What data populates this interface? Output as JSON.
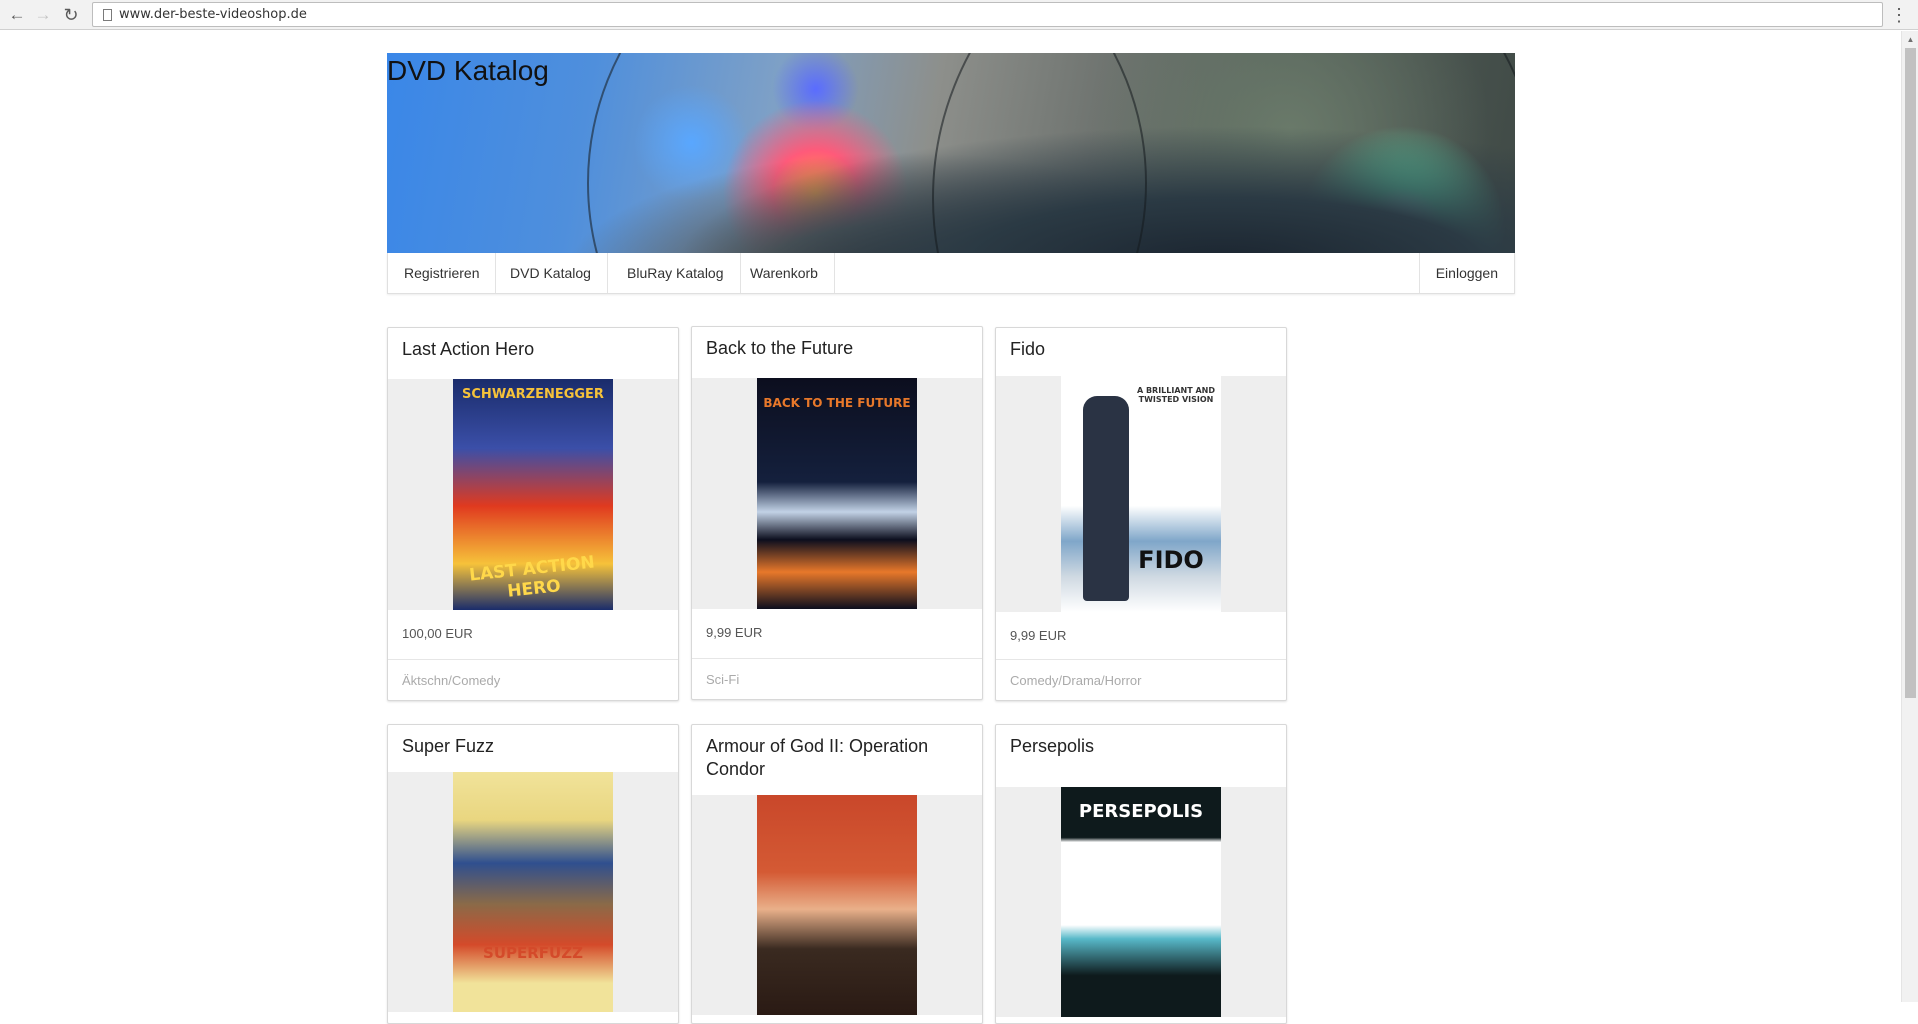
{
  "browser": {
    "url": "www.der-beste-videoshop.de"
  },
  "header": {
    "title": "DVD Katalog"
  },
  "nav": {
    "items": [
      {
        "label": "Registrieren"
      },
      {
        "label": "DVD Katalog"
      },
      {
        "label": "BluRay Katalog"
      },
      {
        "label": "Warenkorb"
      }
    ],
    "login_label": "Einloggen"
  },
  "products": [
    {
      "title": "Last Action Hero",
      "price": "100,00 EUR",
      "genre": "Äktschn/Comedy",
      "poster_text": "LAST ACTION HERO",
      "poster_top": "SCHWARZENEGGER",
      "colors": [
        "#1a2c6b",
        "#e03a1f",
        "#f6c23a"
      ]
    },
    {
      "title": "Back to the Future",
      "price": "9,99 EUR",
      "genre": "Sci-Fi",
      "poster_text": "BACK TO THE FUTURE",
      "poster_top": "",
      "colors": [
        "#0c0e1e",
        "#e8782a",
        "#dfe5ee"
      ]
    },
    {
      "title": "Fido",
      "price": "9,99 EUR",
      "genre": "Comedy/Drama/Horror",
      "poster_text": "FIDO",
      "poster_top": "A BRILLIANT AND TWISTED VISION",
      "colors": [
        "#ffffff",
        "#2a3344",
        "#7fa6c9"
      ]
    },
    {
      "title": "Super Fuzz",
      "price": "",
      "genre": "",
      "poster_text": "SUPERFUZZ",
      "poster_top": "",
      "colors": [
        "#f1e39a",
        "#d44a2a",
        "#2f4f8f"
      ]
    },
    {
      "title": "Armour of God II: Operation Condor",
      "price": "",
      "genre": "",
      "poster_text": "",
      "poster_top": "",
      "colors": [
        "#c9472a",
        "#2a1a14",
        "#e9b08a"
      ]
    },
    {
      "title": "Persepolis",
      "price": "",
      "genre": "",
      "poster_text": "PERSEPOLIS",
      "poster_top": "",
      "colors": [
        "#0e1a1c",
        "#ffffff",
        "#58b9c9"
      ]
    }
  ],
  "icons": {
    "back": "arrow-left-icon",
    "forward": "arrow-right-icon",
    "reload": "reload-icon",
    "page": "page-icon",
    "menu": "menu-dots-icon"
  }
}
